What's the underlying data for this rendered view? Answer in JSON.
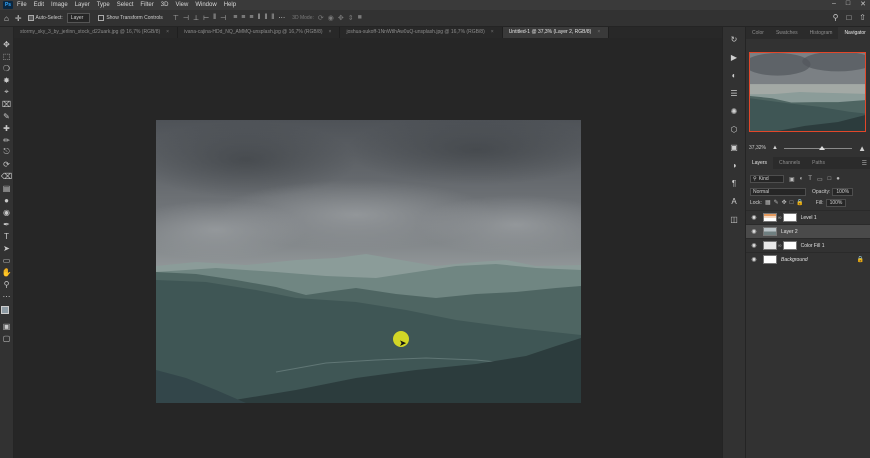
{
  "menubar": {
    "app_badge": "Ps",
    "items": [
      "File",
      "Edit",
      "Image",
      "Layer",
      "Type",
      "Select",
      "Filter",
      "3D",
      "View",
      "Window",
      "Help"
    ]
  },
  "options": {
    "auto_select_label": "Auto-Select:",
    "auto_select_value": "Layer",
    "transform_label": "Show Transform Controls",
    "mode_3d_label": "3D Mode:"
  },
  "tabs": [
    {
      "label": "stormy_sky_3_by_jerlinn_stock_d22uark.jpg @ 16,7% (RGB/8)"
    },
    {
      "label": "ivana-cajina-HDd_NQ_AMMQ-unsplash.jpg @ 16,7% (RGB/8)"
    },
    {
      "label": "joshua-sukoff-1NnWtlhAw0uQ-unsplash.jpg @ 16,7% (RGB/8)"
    },
    {
      "label": "Untitled-1 @ 37,3% (Layer 2, RGB/8)"
    }
  ],
  "panel_tabs": [
    "Color",
    "Swatches",
    "Histogram",
    "Navigator"
  ],
  "navigator": {
    "zoom": "37,32%"
  },
  "layers_tabs": [
    "Layers",
    "Channels",
    "Paths"
  ],
  "layers_panel": {
    "filter_kind": "Kind",
    "blend_mode": "Normal",
    "opacity_label": "Opacity:",
    "opacity_value": "100%",
    "lock_label": "Lock:",
    "fill_label": "Fill:",
    "fill_value": "100%"
  },
  "layers": [
    {
      "name": "Level 1"
    },
    {
      "name": "Layer 2"
    },
    {
      "name": "Color Fill 1"
    },
    {
      "name": "Background"
    }
  ],
  "colors": {
    "accent_nav": "#e2472a",
    "highlight": "#ecec1e"
  }
}
